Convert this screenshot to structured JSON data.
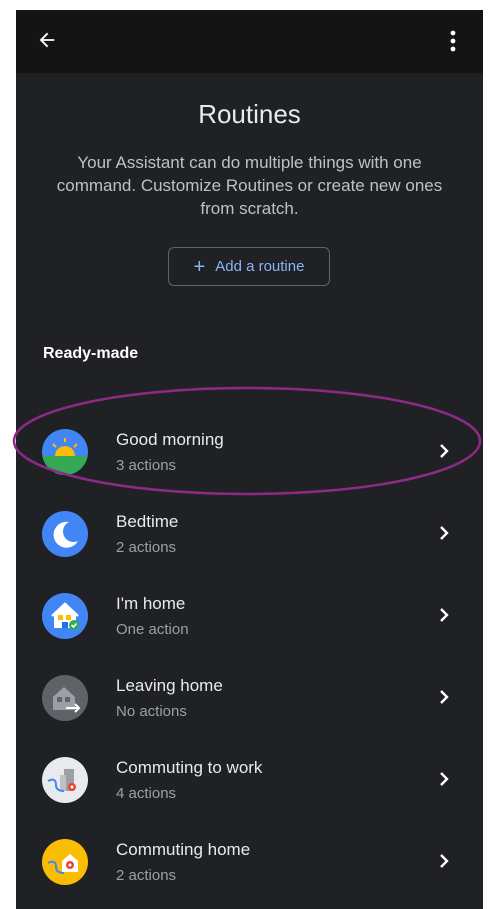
{
  "header": {
    "back_icon": "arrow-back-icon",
    "more_icon": "more-vert-icon"
  },
  "page": {
    "title": "Routines",
    "description": "Your Assistant can do multiple things with one command. Customize Routines or create new ones from scratch.",
    "add_button_label": "Add a routine",
    "section_title": "Ready-made"
  },
  "routines": [
    {
      "name": "Good morning",
      "count": "3 actions",
      "icon": "sunrise-icon"
    },
    {
      "name": "Bedtime",
      "count": "2 actions",
      "icon": "moon-icon"
    },
    {
      "name": "I'm home",
      "count": "One action",
      "icon": "home-check-icon"
    },
    {
      "name": "Leaving home",
      "count": "No actions",
      "icon": "leaving-home-icon"
    },
    {
      "name": "Commuting to work",
      "count": "4 actions",
      "icon": "commute-work-icon"
    },
    {
      "name": "Commuting home",
      "count": "2 actions",
      "icon": "commute-home-icon"
    }
  ],
  "colors": {
    "background": "#202124",
    "topbar": "#141414",
    "accent": "#8ab4f8",
    "highlight_ring": "#8e2a86"
  }
}
